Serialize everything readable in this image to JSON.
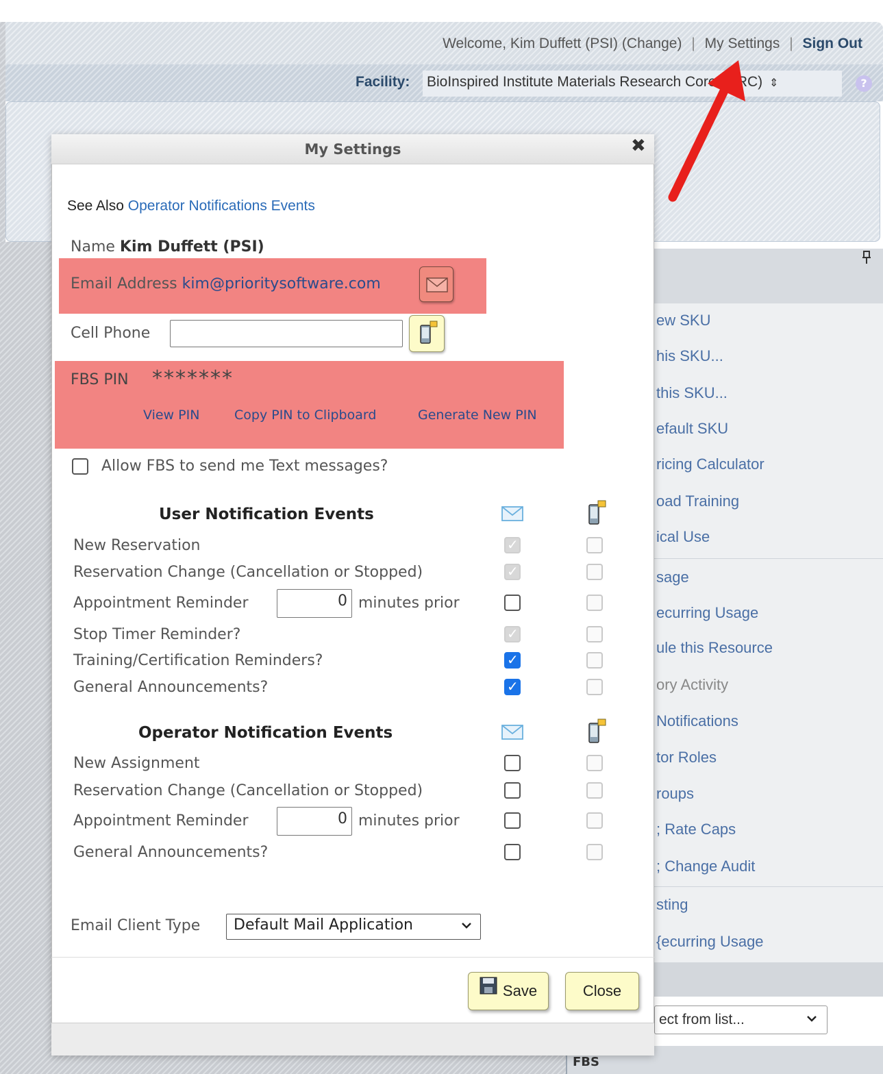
{
  "header": {
    "welcome_prefix": "Welcome, Kim Duffett (PSI)",
    "change_link": "(Change)",
    "separator": "|",
    "my_settings_link": "My Settings",
    "sign_out_link": "Sign Out"
  },
  "facility": {
    "label": "Facility:",
    "value": "BioInspired Institute Materials Research Core (MRC)",
    "dropdown_glyph": "⇕",
    "help_glyph": "?"
  },
  "right_panel": {
    "items": [
      "ew SKU",
      "his SKU...",
      "this SKU...",
      "efault SKU",
      "ricing Calculator",
      "oad Training",
      "ical Use",
      "sage",
      "ecurring Usage",
      "ule this Resource",
      "ory Activity",
      "Notifications",
      "tor Roles",
      "roups",
      "; Rate Caps",
      "; Change Audit",
      "sting",
      "{ecurring Usage"
    ],
    "select_placeholder": "ect from list...",
    "footer_label": "FBS"
  },
  "dialog": {
    "title": "My Settings",
    "close_glyph": "✖",
    "see_also_label": "See Also",
    "see_also_link": "Operator Notifications Events",
    "name_label": "Name",
    "name_value": "Kim Duffett (PSI)",
    "email_label": "Email Address",
    "email_value": "kim@prioritysoftware.com",
    "cell_label": "Cell Phone",
    "cell_value": "",
    "pin_label": "FBS PIN",
    "pin_value": "*******",
    "pin_links": [
      "View PIN",
      "Copy PIN to Clipboard",
      "Generate New PIN"
    ],
    "allow_text_label": "Allow FBS to send me Text messages?",
    "allow_text_checked": false,
    "user_section_title": "User Notification Events",
    "operator_section_title": "Operator Notification Events",
    "minutes_suffix": "minutes prior",
    "user_events": [
      {
        "label": "New Reservation",
        "email": "checked-disabled",
        "sms": "disabled"
      },
      {
        "label": "Reservation Change (Cancellation or Stopped)",
        "email": "checked-disabled",
        "sms": "disabled"
      },
      {
        "label": "Appointment Reminder",
        "minutes": "0",
        "email": "unchecked",
        "sms": "disabled"
      },
      {
        "label": "Stop Timer Reminder?",
        "email": "checked-disabled",
        "sms": "disabled"
      },
      {
        "label": "Training/Certification Reminders?",
        "email": "checked",
        "sms": "disabled"
      },
      {
        "label": "General Announcements?",
        "email": "checked",
        "sms": "disabled"
      }
    ],
    "operator_events": [
      {
        "label": "New Assignment",
        "email": "unchecked",
        "sms": "disabled"
      },
      {
        "label": "Reservation Change (Cancellation or Stopped)",
        "email": "unchecked",
        "sms": "disabled"
      },
      {
        "label": "Appointment Reminder",
        "minutes": "0",
        "email": "unchecked",
        "sms": "disabled"
      },
      {
        "label": "General Announcements?",
        "email": "unchecked",
        "sms": "disabled"
      }
    ],
    "email_client_label": "Email Client Type",
    "email_client_value": "Default Mail Application",
    "save_label": "Save",
    "close_label": "Close"
  },
  "colors": {
    "highlight": "#f28482",
    "link": "#2a6bb8",
    "checkbox_blue": "#1a73e8",
    "annotation_arrow": "#e8201c",
    "button_yellow": "#fdfbc9"
  },
  "icons": {
    "email_column": "envelope-icon",
    "sms_column": "mobile-phone-icon",
    "save": "floppy-disk-icon",
    "pin": "pushpin-icon"
  }
}
